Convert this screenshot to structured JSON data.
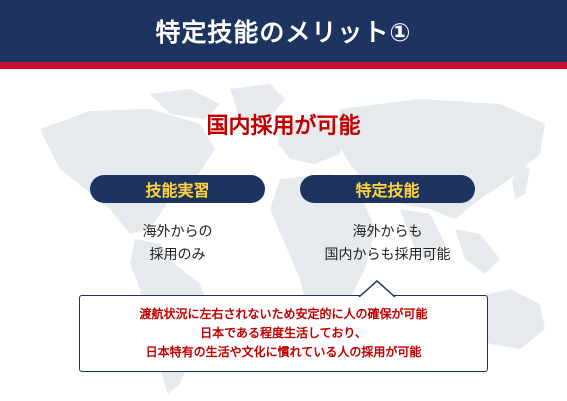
{
  "header": {
    "title": "特定技能のメリット①"
  },
  "headline": "国内採用が可能",
  "left": {
    "label": "技能実習",
    "lines": [
      "海外からの",
      "採用のみ"
    ]
  },
  "right": {
    "label": "特定技能",
    "lines": [
      "海外からも",
      "国内からも採用可能"
    ]
  },
  "callout": {
    "lines": [
      "渡航状況に左右されないため安定的に人の確保が可能",
      "日本である程度生活しており、",
      "日本特有の生活や文化に慣れている人の採用が可能"
    ]
  },
  "colors": {
    "navy": "#1d3461",
    "red": "#c8102e",
    "accent_text": "#c00000",
    "pill_text": "#ffd43b",
    "map": "#e6e9ee"
  }
}
